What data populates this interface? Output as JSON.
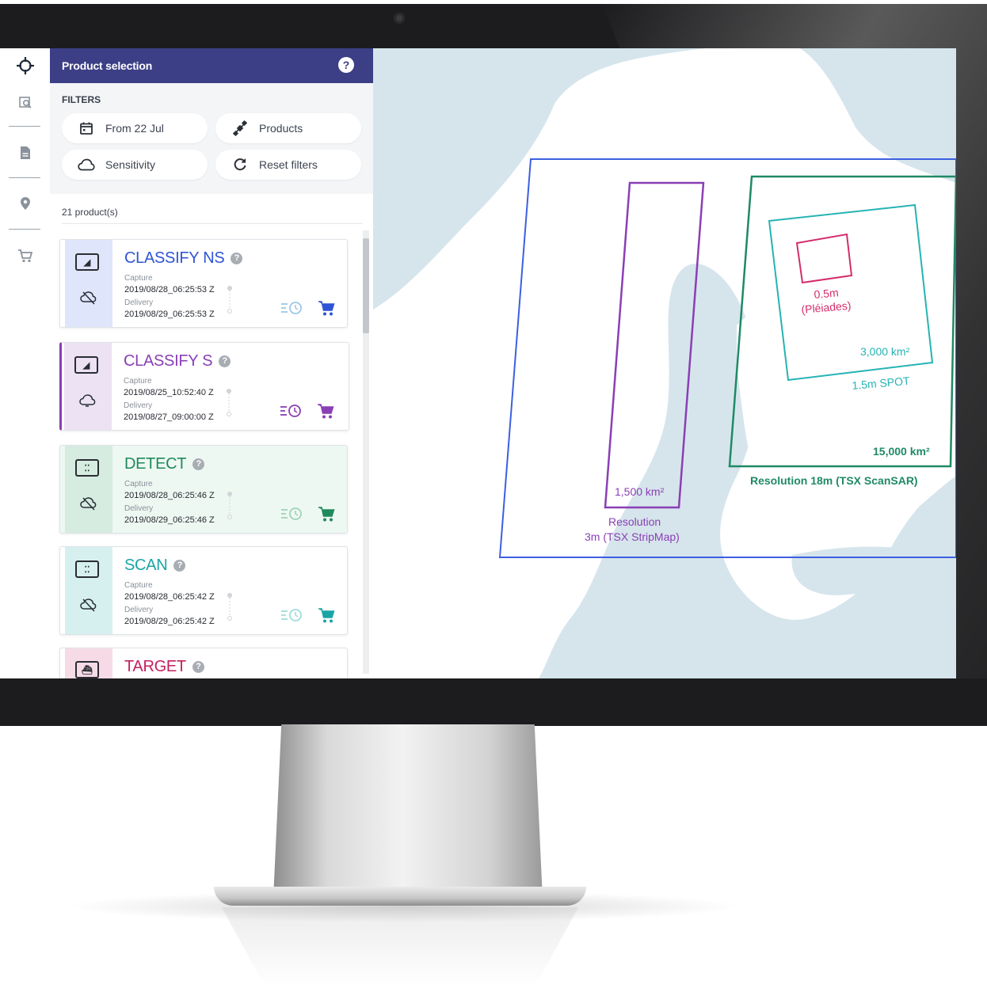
{
  "panel": {
    "title": "Product selection",
    "help": "?",
    "filters_title": "FILTERS",
    "filters": [
      {
        "label": "From 22 Jul",
        "icon": "calendar-icon"
      },
      {
        "label": "Products",
        "icon": "satellite-icon"
      },
      {
        "label": "Sensitivity",
        "icon": "cloud-icon"
      },
      {
        "label": "Reset filters",
        "icon": "refresh-icon"
      }
    ],
    "count": "21 product(s)"
  },
  "rail": {
    "items": [
      "crosshair-icon",
      "image-search-icon",
      "document-icon",
      "location-pin-icon",
      "cart-icon"
    ]
  },
  "products": [
    {
      "name": "CLASSIFY NS",
      "color": "#2f55d4",
      "side": "#dfe5fb",
      "q": "?",
      "capture_label": "Capture",
      "capture": "2019/08/28_06:25:53 Z",
      "delivery_label": "Delivery",
      "delivery": "2019/08/29_06:25:53 Z"
    },
    {
      "name": "CLASSIFY S",
      "color": "#8a3fb5",
      "side": "#ece2f3",
      "q": "?",
      "capture_label": "Capture",
      "capture": "2019/08/25_10:52:40 Z",
      "delivery_label": "Delivery",
      "delivery": "2019/08/27_09:00:00 Z"
    },
    {
      "name": "DETECT",
      "color": "#1f8a5c",
      "side": "#d6ece1",
      "q": "?",
      "capture_label": "Capture",
      "capture": "2019/08/28_06:25:46 Z",
      "delivery_label": "Delivery",
      "delivery": "2019/08/29_06:25:46 Z"
    },
    {
      "name": "SCAN",
      "color": "#1aa5a5",
      "side": "#d6f0ef",
      "q": "?",
      "capture_label": "Capture",
      "capture": "2019/08/28_06:25:42 Z",
      "delivery_label": "Delivery",
      "delivery": "2019/08/29_06:25:42 Z"
    },
    {
      "name": "TARGET",
      "color": "#c4205e",
      "side": "#f6dbe6",
      "q": "?"
    }
  ],
  "map": {
    "colors": {
      "land": "#ffffff",
      "water": "#d6e5ec",
      "tsx_stripmap_outer": "#3c5fe0",
      "tsx_stripmap": "#8a3fb5",
      "tsx_scansar": "#1f8a64",
      "spot": "#26b3b3",
      "pleiades": "#d42c6b"
    },
    "labels": {
      "stripmap_area": "1,500 km²",
      "stripmap_res_1": "Resolution",
      "stripmap_res_2": "3m (TSX StripMap)",
      "scansar_area": "15,000 km²",
      "scansar_res": "Resolution 18m (TSX ScanSAR)",
      "spot_area": "3,000 km²",
      "spot_res": "1.5m SPOT",
      "pleiades_res_1": "0.5m",
      "pleiades_res_2": "(Pléiades)"
    }
  }
}
